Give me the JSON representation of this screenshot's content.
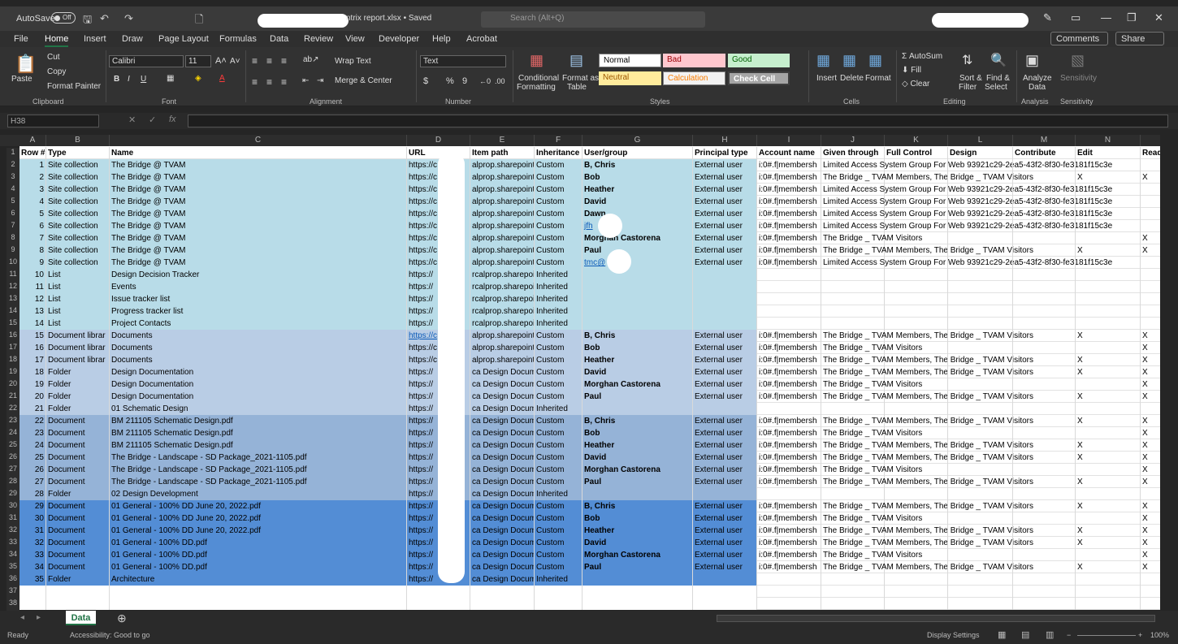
{
  "title": {
    "autosave": "AutoSave",
    "toggle": "Off",
    "filename": "ntrix report.xlsx • Saved",
    "search": "Search (Alt+Q)"
  },
  "menu": {
    "file": "File",
    "home": "Home",
    "insert": "Insert",
    "draw": "Draw",
    "pagelayout": "Page Layout",
    "formulas": "Formulas",
    "data": "Data",
    "review": "Review",
    "view": "View",
    "developer": "Developer",
    "help": "Help",
    "acrobat": "Acrobat",
    "comments": "Comments",
    "share": "Share"
  },
  "ribbon": {
    "paste": "Paste",
    "cut": "Cut",
    "copy": "Copy",
    "formatpainter": "Format Painter",
    "clipboard": "Clipboard",
    "font": "Calibri",
    "size": "11",
    "fontlabel": "Font",
    "wrap": "Wrap Text",
    "merge": "Merge & Center",
    "alignment": "Alignment",
    "numfmt": "Text",
    "number": "Number",
    "conditional": "Conditional",
    "formatting": "Formatting",
    "formatas": "Format as",
    "table": "Table",
    "normal": "Normal",
    "bad": "Bad",
    "good": "Good",
    "neutral": "Neutral",
    "calculation": "Calculation",
    "checkcell": "Check Cell",
    "styles": "Styles",
    "insert": "Insert",
    "delete": "Delete",
    "format": "Format",
    "cells": "Cells",
    "autosum": "AutoSum",
    "fill": "Fill",
    "clear": "Clear",
    "sortfilter": "Sort &",
    "filter": "Filter",
    "findselect": "Find &",
    "select": "Select",
    "editing": "Editing",
    "analyze": "Analyze",
    "analyzedata": "Data",
    "analysis": "Analysis",
    "sensitivity": "Sensitivity"
  },
  "namebox": "H38",
  "columns": [
    "A",
    "B",
    "C",
    "D",
    "E",
    "F",
    "G",
    "H",
    "I",
    "J",
    "K",
    "L",
    "M",
    "N"
  ],
  "rows": [
    [
      "Row #",
      "Type",
      "Name",
      "URL",
      "Item path",
      "Inheritance",
      "User/group",
      "Principal type",
      "Account name",
      "Given through",
      "Full Control",
      "Design",
      "Contribute",
      "Edit",
      "Read"
    ],
    [
      "1",
      "Site collection",
      "The Bridge @ TVAM",
      "https://c",
      "alprop.sharepoint.",
      "Custom",
      "B, Chris",
      "External user",
      "i:0#.f|membersh",
      "Limited Access System Group For Web 93921c29-2ea5-43f2-8f30-fe3181f15c3e",
      "",
      "",
      "",
      "",
      ""
    ],
    [
      "2",
      "Site collection",
      "The Bridge @ TVAM",
      "https://c",
      "alprop.sharepoint.",
      "Custom",
      "Bob",
      "External user",
      "i:0#.f|membersh",
      "The Bridge _ TVAM Members, The Bridge _ TVAM Visitors",
      "",
      "",
      "",
      "X",
      "X"
    ],
    [
      "3",
      "Site collection",
      "The Bridge @ TVAM",
      "https://c",
      "alprop.sharepoint.",
      "Custom",
      "Heather",
      "External user",
      "i:0#.f|membersh",
      "Limited Access System Group For Web 93921c29-2ea5-43f2-8f30-fe3181f15c3e",
      "",
      "",
      "",
      "",
      ""
    ],
    [
      "4",
      "Site collection",
      "The Bridge @ TVAM",
      "https://c",
      "alprop.sharepoint.",
      "Custom",
      "David",
      "External user",
      "i:0#.f|membersh",
      "Limited Access System Group For Web 93921c29-2ea5-43f2-8f30-fe3181f15c3e",
      "",
      "",
      "",
      "",
      ""
    ],
    [
      "5",
      "Site collection",
      "The Bridge @ TVAM",
      "https://c",
      "alprop.sharepoint.",
      "Custom",
      "Dawn",
      "External user",
      "i:0#.f|membersh",
      "Limited Access System Group For Web 93921c29-2ea5-43f2-8f30-fe3181f15c3e",
      "",
      "",
      "",
      "",
      ""
    ],
    [
      "6",
      "Site collection",
      "The Bridge @ TVAM",
      "https://c",
      "alprop.sharepoint.",
      "Custom",
      "jfh",
      "External user",
      "i:0#.f|membersh",
      "Limited Access System Group For Web 93921c29-2ea5-43f2-8f30-fe3181f15c3e",
      "",
      "",
      "",
      "",
      ""
    ],
    [
      "7",
      "Site collection",
      "The Bridge @ TVAM",
      "https://c",
      "alprop.sharepoint.",
      "Custom",
      "Morghan Castorena",
      "External user",
      "i:0#.f|membersh",
      "The Bridge _ TVAM Visitors",
      "",
      "",
      "",
      "",
      "X"
    ],
    [
      "8",
      "Site collection",
      "The Bridge @ TVAM",
      "https://c",
      "alprop.sharepoint.",
      "Custom",
      "Paul",
      "External user",
      "i:0#.f|membersh",
      "The Bridge _ TVAM Members, The Bridge _ TVAM Visitors",
      "",
      "",
      "",
      "X",
      "X"
    ],
    [
      "9",
      "Site collection",
      "The Bridge @ TVAM",
      "https://c",
      "alprop.sharepoint.",
      "Custom",
      "tmc@",
      "External user",
      "i:0#.f|membersh",
      "Limited Access System Group For Web 93921c29-2ea5-43f2-8f30-fe3181f15c3e",
      "",
      "",
      "",
      "",
      ""
    ],
    [
      "10",
      "List",
      "Design Decision Tracker",
      "https://",
      "rcalprop.sharepoint.",
      "Inherited",
      "",
      "",
      "",
      "",
      "",
      "",
      "",
      "",
      ""
    ],
    [
      "11",
      "List",
      "Events",
      "https://",
      "rcalprop.sharepoint.",
      "Inherited",
      "",
      "",
      "",
      "",
      "",
      "",
      "",
      "",
      ""
    ],
    [
      "12",
      "List",
      "Issue tracker list",
      "https://",
      "rcalprop.sharepoint.",
      "Inherited",
      "",
      "",
      "",
      "",
      "",
      "",
      "",
      "",
      ""
    ],
    [
      "13",
      "List",
      "Progress tracker list",
      "https://",
      "rcalprop.sharepoint.",
      "Inherited",
      "",
      "",
      "",
      "",
      "",
      "",
      "",
      "",
      ""
    ],
    [
      "14",
      "List",
      "Project Contacts",
      "https://",
      "rcalprop.sharepoint.",
      "Inherited",
      "",
      "",
      "",
      "",
      "",
      "",
      "",
      "",
      ""
    ],
    [
      "15",
      "Document librar",
      "Documents",
      "https://c",
      "alprop.sharepoint.",
      "Custom",
      "B, Chris",
      "External user",
      "i:0#.f|membersh",
      "The Bridge _ TVAM Members, The Bridge _ TVAM Visitors",
      "",
      "",
      "",
      "X",
      "X"
    ],
    [
      "16",
      "Document librar",
      "Documents",
      "https://c",
      "alprop.sharepoint.",
      "Custom",
      "Bob",
      "External user",
      "i:0#.f|membersh",
      "The Bridge _ TVAM Visitors",
      "",
      "",
      "",
      "",
      "X"
    ],
    [
      "17",
      "Document librar",
      "Documents",
      "https://c",
      "alprop.sharepoint.",
      "Custom",
      "Heather",
      "External user",
      "i:0#.f|membersh",
      "The Bridge _ TVAM Members, The Bridge _ TVAM Visitors",
      "",
      "",
      "",
      "X",
      "X"
    ],
    [
      "18",
      "Folder",
      "Design Documentation",
      "https://",
      "ca Design Documer",
      "Custom",
      "David",
      "External user",
      "i:0#.f|membersh",
      "The Bridge _ TVAM Members, The Bridge _ TVAM Visitors",
      "",
      "",
      "",
      "X",
      "X"
    ],
    [
      "19",
      "Folder",
      "Design Documentation",
      "https://",
      "ca Design Documer",
      "Custom",
      "Morghan Castorena",
      "External user",
      "i:0#.f|membersh",
      "The Bridge _ TVAM Visitors",
      "",
      "",
      "",
      "",
      "X"
    ],
    [
      "20",
      "Folder",
      "Design Documentation",
      "https://",
      "ca Design Documer",
      "Custom",
      "Paul",
      "External user",
      "i:0#.f|membersh",
      "The Bridge _ TVAM Members, The Bridge _ TVAM Visitors",
      "",
      "",
      "",
      "X",
      "X"
    ],
    [
      "21",
      "Folder",
      "01 Schematic Design",
      "https://",
      "ca Design Documer",
      "Inherited",
      "",
      "",
      "",
      "",
      "",
      "",
      "",
      "",
      ""
    ],
    [
      "22",
      "Document",
      "BM 211105 Schematic Design.pdf",
      "https://",
      "ca Design Documer",
      "Custom",
      "B, Chris",
      "External user",
      "i:0#.f|membersh",
      "The Bridge _ TVAM Members, The Bridge _ TVAM Visitors",
      "",
      "",
      "",
      "X",
      "X"
    ],
    [
      "23",
      "Document",
      "BM 211105 Schematic Design.pdf",
      "https://",
      "ca Design Documer",
      "Custom",
      "Bob",
      "External user",
      "i:0#.f|membersh",
      "The Bridge _ TVAM Visitors",
      "",
      "",
      "",
      "",
      "X"
    ],
    [
      "24",
      "Document",
      "BM 211105 Schematic Design.pdf",
      "https://",
      "ca Design Documer",
      "Custom",
      "Heather",
      "External user",
      "i:0#.f|membersh",
      "The Bridge _ TVAM Members, The Bridge _ TVAM Visitors",
      "",
      "",
      "",
      "X",
      "X"
    ],
    [
      "25",
      "Document",
      "The Bridge - Landscape - SD Package_2021-1105.pdf",
      "https://",
      "ca Design Documer",
      "Custom",
      "David",
      "External user",
      "i:0#.f|membersh",
      "The Bridge _ TVAM Members, The Bridge _ TVAM Visitors",
      "",
      "",
      "",
      "X",
      "X"
    ],
    [
      "26",
      "Document",
      "The Bridge - Landscape - SD Package_2021-1105.pdf",
      "https://",
      "ca Design Documer",
      "Custom",
      "Morghan Castorena",
      "External user",
      "i:0#.f|membersh",
      "The Bridge _ TVAM Visitors",
      "",
      "",
      "",
      "",
      "X"
    ],
    [
      "27",
      "Document",
      "The Bridge - Landscape - SD Package_2021-1105.pdf",
      "https://",
      "ca Design Documer",
      "Custom",
      "Paul",
      "External user",
      "i:0#.f|membersh",
      "The Bridge _ TVAM Members, The Bridge _ TVAM Visitors",
      "",
      "",
      "",
      "X",
      "X"
    ],
    [
      "28",
      "Folder",
      "02 Design Development",
      "https://",
      "ca Design Documer",
      "Inherited",
      "",
      "",
      "",
      "",
      "",
      "",
      "",
      "",
      ""
    ],
    [
      "29",
      "Document",
      "01 General - 100% DD June 20, 2022.pdf",
      "https://",
      "ca Design Documer",
      "Custom",
      "B, Chris",
      "External user",
      "i:0#.f|membersh",
      "The Bridge _ TVAM Members, The Bridge _ TVAM Visitors",
      "",
      "",
      "",
      "X",
      "X"
    ],
    [
      "30",
      "Document",
      "01 General - 100% DD June 20, 2022.pdf",
      "https://",
      "ca Design Documer",
      "Custom",
      "Bob",
      "External user",
      "i:0#.f|membersh",
      "The Bridge _ TVAM Visitors",
      "",
      "",
      "",
      "",
      "X"
    ],
    [
      "31",
      "Document",
      "01 General - 100% DD June 20, 2022.pdf",
      "https://",
      "ca Design Documer",
      "Custom",
      "Heather",
      "External user",
      "i:0#.f|membersh",
      "The Bridge _ TVAM Members, The Bridge _ TVAM Visitors",
      "",
      "",
      "",
      "X",
      "X"
    ],
    [
      "32",
      "Document",
      "01 General - 100% DD.pdf",
      "https://",
      "ca Design Documer",
      "Custom",
      "David",
      "External user",
      "i:0#.f|membersh",
      "The Bridge _ TVAM Members, The Bridge _ TVAM Visitors",
      "",
      "",
      "",
      "X",
      "X"
    ],
    [
      "33",
      "Document",
      "01 General - 100% DD.pdf",
      "https://",
      "ca Design Documer",
      "Custom",
      "Morghan Castorena",
      "External user",
      "i:0#.f|membersh",
      "The Bridge _ TVAM Visitors",
      "",
      "",
      "",
      "",
      "X"
    ],
    [
      "34",
      "Document",
      "01 General - 100% DD.pdf",
      "https://",
      "ca Design Documer",
      "Custom",
      "Paul",
      "External user",
      "i:0#.f|membersh",
      "The Bridge _ TVAM Members, The Bridge _ TVAM Visitors",
      "",
      "",
      "",
      "X",
      "X"
    ],
    [
      "35",
      "Folder",
      "Architecture",
      "https://",
      "ca Design Documer",
      "Inherited",
      "",
      "",
      "",
      "",
      "",
      "",
      "",
      "",
      ""
    ],
    [
      "",
      "",
      "",
      "",
      "",
      "",
      "",
      "",
      "",
      "",
      "",
      "",
      "",
      "",
      ""
    ],
    [
      "",
      "",
      "",
      "",
      "",
      "",
      "",
      "",
      "",
      "",
      "",
      "",
      "",
      "",
      ""
    ]
  ],
  "rowfills": [
    "#ffffff",
    "#b8dce8",
    "#b8dce8",
    "#b8dce8",
    "#b8dce8",
    "#b8dce8",
    "#b8dce8",
    "#b8dce8",
    "#b8dce8",
    "#b8dce8",
    "#b8dce8",
    "#b8dce8",
    "#b8dce8",
    "#b8dce8",
    "#b8dce8",
    "#b9cde5",
    "#b9cde5",
    "#b9cde5",
    "#b9cde5",
    "#b9cde5",
    "#b9cde5",
    "#b9cde5",
    "#95b3d7",
    "#95b3d7",
    "#95b3d7",
    "#95b3d7",
    "#95b3d7",
    "#95b3d7",
    "#95b3d7",
    "#538dd5",
    "#538dd5",
    "#538dd5",
    "#538dd5",
    "#538dd5",
    "#538dd5",
    "#538dd5",
    "#ffffff",
    "#ffffff"
  ],
  "sheet": "Data",
  "status": {
    "ready": "Ready",
    "accessibility": "Accessibility: Good to go",
    "display": "Display Settings",
    "zoom": "100%"
  }
}
